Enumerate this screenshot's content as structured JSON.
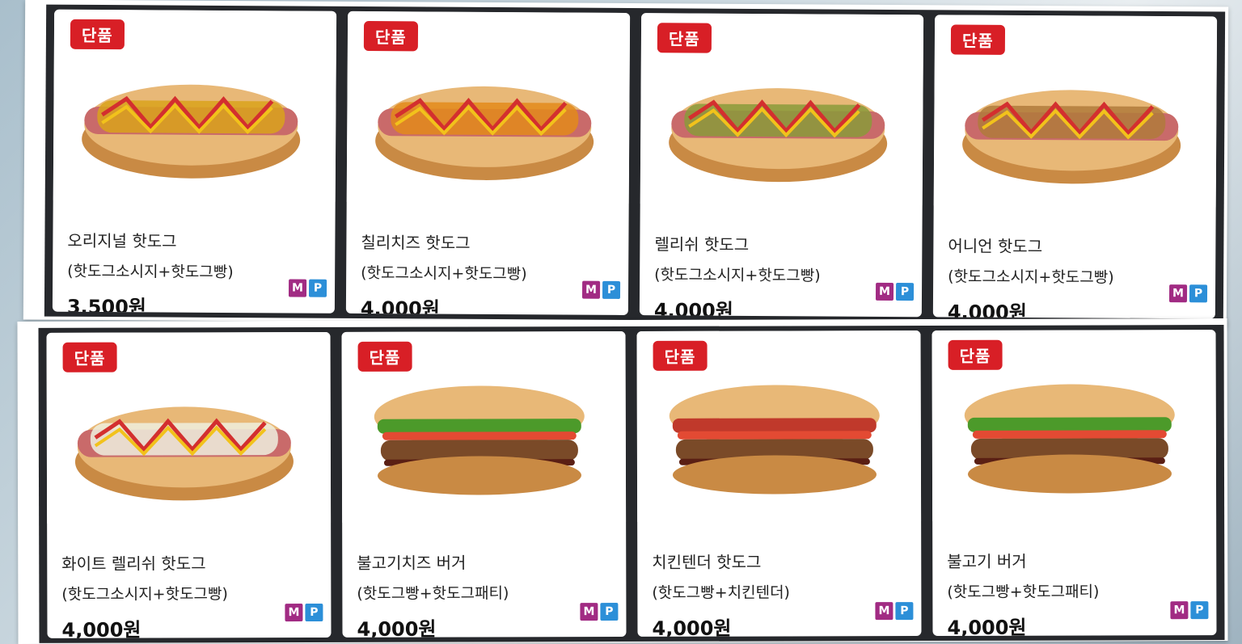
{
  "rows": [
    [
      {
        "badge": "단품",
        "name": "오리지널 핫도그",
        "sub": "(핫도그소시지+핫도그빵)",
        "price": "3,500원",
        "pay_m": "M",
        "pay_p": "P",
        "topping": "#d9a21b",
        "type": "hotdog"
      },
      {
        "badge": "단품",
        "name": "칠리치즈 핫도그",
        "sub": "(핫도그소시지+핫도그빵)",
        "price": "4,000원",
        "pay_m": "M",
        "pay_p": "P",
        "topping": "#e38a1a",
        "type": "hotdog"
      },
      {
        "badge": "단품",
        "name": "렐리쉬 핫도그",
        "sub": "(핫도그소시지+핫도그빵)",
        "price": "4,000원",
        "pay_m": "M",
        "pay_p": "P",
        "topping": "#8a9a3a",
        "type": "hotdog"
      },
      {
        "badge": "단품",
        "name": "어니언 핫도그",
        "sub": "(핫도그소시지+핫도그빵)",
        "price": "4,000원",
        "pay_m": "M",
        "pay_p": "P",
        "topping": "#b07a3b",
        "type": "hotdog"
      }
    ],
    [
      {
        "badge": "단품",
        "name": "화이트 렐리쉬 핫도그",
        "sub": "(핫도그소시지+핫도그빵)",
        "price": "4,000원",
        "pay_m": "M",
        "pay_p": "P",
        "topping": "#eeeede",
        "type": "hotdog"
      },
      {
        "badge": "단품",
        "name": "불고기치즈 버거",
        "sub": "(핫도그빵+핫도그패티)",
        "price": "4,000원",
        "pay_m": "M",
        "pay_p": "P",
        "topping": "#4c9a2a",
        "type": "burger"
      },
      {
        "badge": "단품",
        "name": "치킨텐더 핫도그",
        "sub": "(핫도그빵+치킨텐더)",
        "price": "4,000원",
        "pay_m": "M",
        "pay_p": "P",
        "topping": "#c0392b",
        "type": "burger"
      },
      {
        "badge": "단품",
        "name": "불고기 버거",
        "sub": "(핫도그빵+핫도그패티)",
        "price": "4,000원",
        "pay_m": "M",
        "pay_p": "P",
        "topping": "#4c9a2a",
        "type": "burger"
      }
    ]
  ]
}
